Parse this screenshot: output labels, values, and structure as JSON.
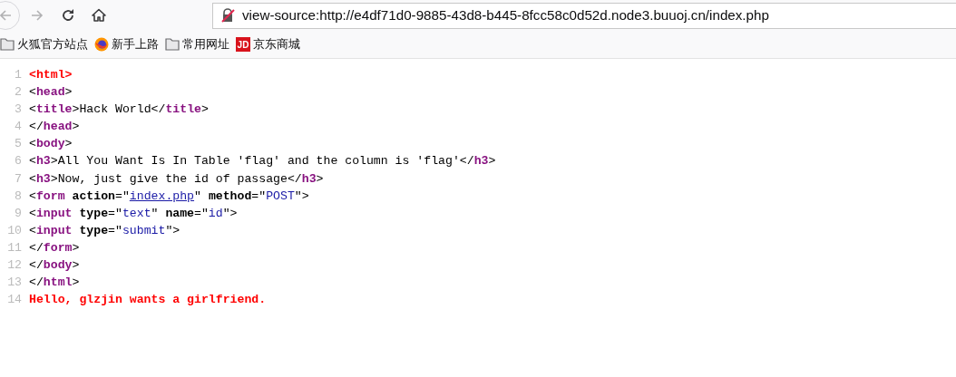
{
  "toolbar": {
    "buttons": [
      {
        "kind": "back",
        "disabled": true
      },
      {
        "kind": "forward",
        "disabled": true
      },
      {
        "kind": "reload",
        "disabled": false
      },
      {
        "kind": "home",
        "disabled": false
      }
    ],
    "address": {
      "secure": false,
      "url": "view-source:http://e4df71d0-9885-43d8-b445-8fcc58c0d52d.node3.buuoj.cn/index.php"
    }
  },
  "bookmarks": [
    {
      "kind": "folder",
      "label": "火狐官方站点"
    },
    {
      "kind": "firefox",
      "label": "新手上路"
    },
    {
      "kind": "folder",
      "label": "常用网址"
    },
    {
      "kind": "jd",
      "icon_text": "JD",
      "label": "京东商城"
    }
  ],
  "source": {
    "lines": [
      {
        "number": "1",
        "tokens": [
          {
            "kind": "error",
            "text": "<html>"
          }
        ]
      },
      {
        "number": "2",
        "tokens": [
          {
            "kind": "punct",
            "text": "<"
          },
          {
            "kind": "tag",
            "text": "head"
          },
          {
            "kind": "punct",
            "text": ">"
          }
        ]
      },
      {
        "number": "3",
        "tokens": [
          {
            "kind": "punct",
            "text": "<"
          },
          {
            "kind": "tag",
            "text": "title"
          },
          {
            "kind": "punct",
            "text": ">Hack World</"
          },
          {
            "kind": "tag",
            "text": "title"
          },
          {
            "kind": "punct",
            "text": ">"
          }
        ]
      },
      {
        "number": "4",
        "tokens": [
          {
            "kind": "punct",
            "text": "</"
          },
          {
            "kind": "tag",
            "text": "head"
          },
          {
            "kind": "punct",
            "text": ">"
          }
        ]
      },
      {
        "number": "5",
        "tokens": [
          {
            "kind": "punct",
            "text": "<"
          },
          {
            "kind": "tag",
            "text": "body"
          },
          {
            "kind": "punct",
            "text": ">"
          }
        ]
      },
      {
        "number": "6",
        "tokens": [
          {
            "kind": "punct",
            "text": "<"
          },
          {
            "kind": "tag",
            "text": "h3"
          },
          {
            "kind": "punct",
            "text": ">All You Want Is In Table 'flag' and the column is 'flag'</"
          },
          {
            "kind": "tag",
            "text": "h3"
          },
          {
            "kind": "punct",
            "text": ">"
          }
        ]
      },
      {
        "number": "7",
        "tokens": [
          {
            "kind": "punct",
            "text": "<"
          },
          {
            "kind": "tag",
            "text": "h3"
          },
          {
            "kind": "punct",
            "text": ">Now, just give the id of passage</"
          },
          {
            "kind": "tag",
            "text": "h3"
          },
          {
            "kind": "punct",
            "text": ">"
          }
        ]
      },
      {
        "number": "8",
        "tokens": [
          {
            "kind": "punct",
            "text": "<"
          },
          {
            "kind": "tag",
            "text": "form "
          },
          {
            "kind": "attr",
            "text": "action"
          },
          {
            "kind": "punct",
            "text": "=\""
          },
          {
            "kind": "link",
            "text": "index.php"
          },
          {
            "kind": "punct",
            "text": "\" "
          },
          {
            "kind": "attr",
            "text": "method"
          },
          {
            "kind": "punct",
            "text": "=\""
          },
          {
            "kind": "value",
            "text": "POST"
          },
          {
            "kind": "punct",
            "text": "\">"
          }
        ]
      },
      {
        "number": "9",
        "tokens": [
          {
            "kind": "punct",
            "text": "<"
          },
          {
            "kind": "tag",
            "text": "input "
          },
          {
            "kind": "attr",
            "text": "type"
          },
          {
            "kind": "punct",
            "text": "=\""
          },
          {
            "kind": "value",
            "text": "text"
          },
          {
            "kind": "punct",
            "text": "\" "
          },
          {
            "kind": "attr",
            "text": "name"
          },
          {
            "kind": "punct",
            "text": "=\""
          },
          {
            "kind": "value",
            "text": "id"
          },
          {
            "kind": "punct",
            "text": "\">"
          }
        ]
      },
      {
        "number": "10",
        "tokens": [
          {
            "kind": "punct",
            "text": "<"
          },
          {
            "kind": "tag",
            "text": "input "
          },
          {
            "kind": "attr",
            "text": "type"
          },
          {
            "kind": "punct",
            "text": "=\""
          },
          {
            "kind": "value",
            "text": "submit"
          },
          {
            "kind": "punct",
            "text": "\">"
          }
        ]
      },
      {
        "number": "11",
        "tokens": [
          {
            "kind": "punct",
            "text": "</"
          },
          {
            "kind": "tag",
            "text": "form"
          },
          {
            "kind": "punct",
            "text": ">"
          }
        ]
      },
      {
        "number": "12",
        "tokens": [
          {
            "kind": "punct",
            "text": "</"
          },
          {
            "kind": "tag",
            "text": "body"
          },
          {
            "kind": "punct",
            "text": ">"
          }
        ]
      },
      {
        "number": "13",
        "tokens": [
          {
            "kind": "punct",
            "text": "</"
          },
          {
            "kind": "tag",
            "text": "html"
          },
          {
            "kind": "punct",
            "text": ">"
          }
        ]
      },
      {
        "number": "14",
        "tokens": [
          {
            "kind": "error",
            "text": "Hello, glzjin wants a girlfriend."
          }
        ]
      }
    ]
  }
}
